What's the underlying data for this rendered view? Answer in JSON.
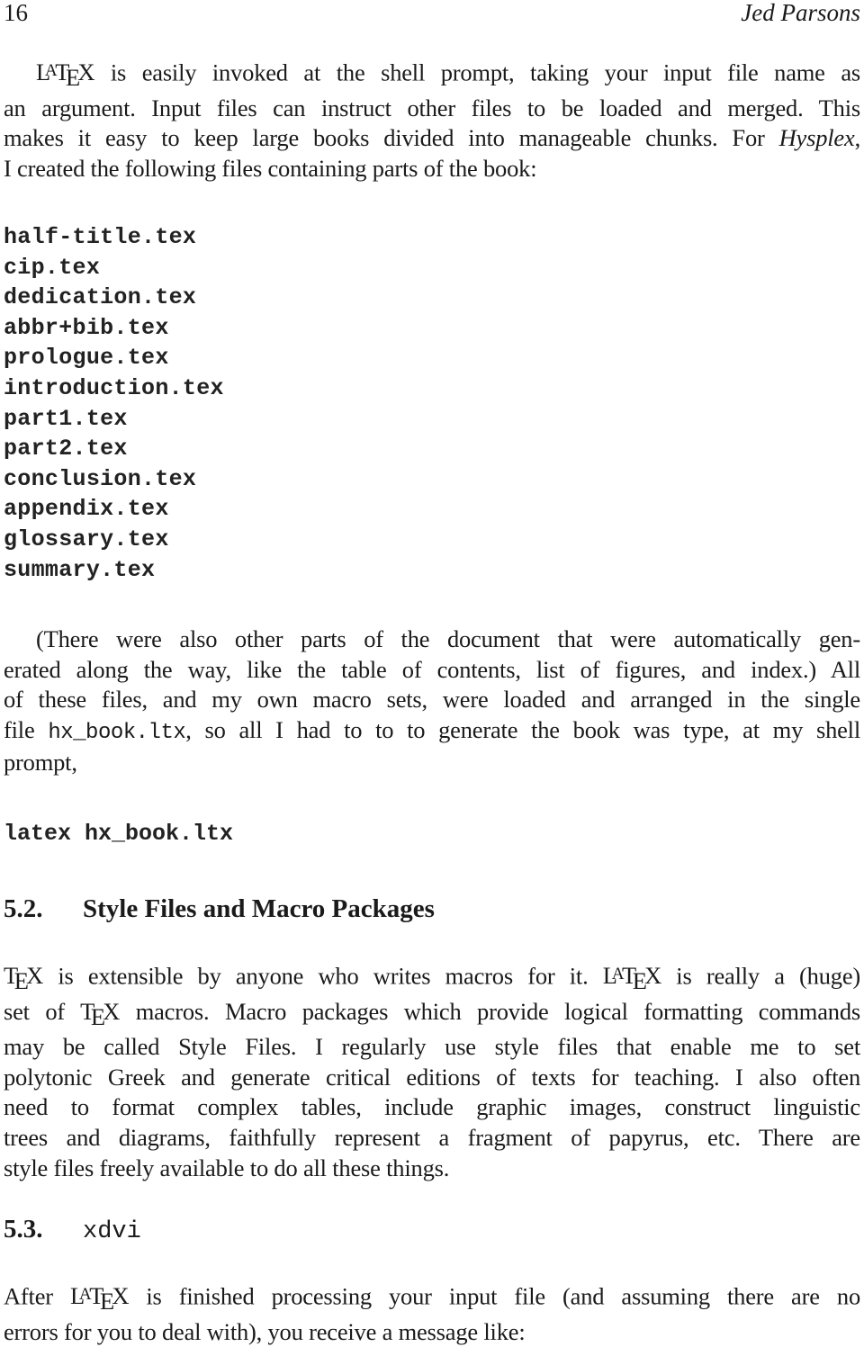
{
  "running_head": {
    "page_number": "16",
    "author": "Jed Parsons"
  },
  "intro_paragraph": {
    "latex_logo": {
      "L": "L",
      "A": "A",
      "T": "T",
      "E": "E",
      "X": "X"
    },
    "line1_rest": " is easily invoked at the shell prompt, taking your input file name as",
    "line2": "an argument. Input files can instruct other files to be loaded and merged. This",
    "line3_pre": "makes it easy to keep large books divided into manageable chunks. For ",
    "line3_italic": "Hysplex",
    "line3_post": ",",
    "line4": "I created the following files containing parts of the book:"
  },
  "file_list": [
    "half-title.tex",
    "cip.tex",
    "dedication.tex",
    "abbr+bib.tex",
    "prologue.tex",
    "introduction.tex",
    "part1.tex",
    "part2.tex",
    "conclusion.tex",
    "appendix.tex",
    "glossary.tex",
    "summary.tex"
  ],
  "generated_paragraph": {
    "line1": "(There were also other parts of the document that were automatically gen-",
    "line2": "erated along the way, like the table of contents, list of figures, and index.) All",
    "line3": "of these files, and my own macro sets, were loaded and arranged in the single",
    "line4_pre": "file ",
    "line4_code": "hx_book.ltx",
    "line4_post": ", so all I had to to to generate the book was type, at my shell",
    "line5": "prompt,"
  },
  "command_line": "latex hx_book.ltx",
  "section_5_2": {
    "number": "5.2.",
    "title": "Style Files and Macro Packages",
    "line1_a": " is extensible by anyone who writes macros for it. ",
    "line1_b": " is really a (huge)",
    "line2_a": "set of ",
    "line2_b": " macros. Macro packages which provide logical formatting commands",
    "line3": "may be called Style Files. I regularly use style files that enable me to set",
    "line4": "polytonic Greek and generate critical editions of texts for teaching. I also often",
    "line5": "need to format complex tables, include graphic images, construct linguistic",
    "line6": "trees and diagrams, faithfully represent a fragment of papyrus, etc. There are",
    "line7": "style files freely available to do all these things."
  },
  "section_5_3": {
    "number": "5.3.",
    "title": "xdvi",
    "line1_a": "After ",
    "line1_b": " is finished processing your input file (and assuming there are no",
    "line2": "errors for you to deal with), you receive a message like:"
  }
}
